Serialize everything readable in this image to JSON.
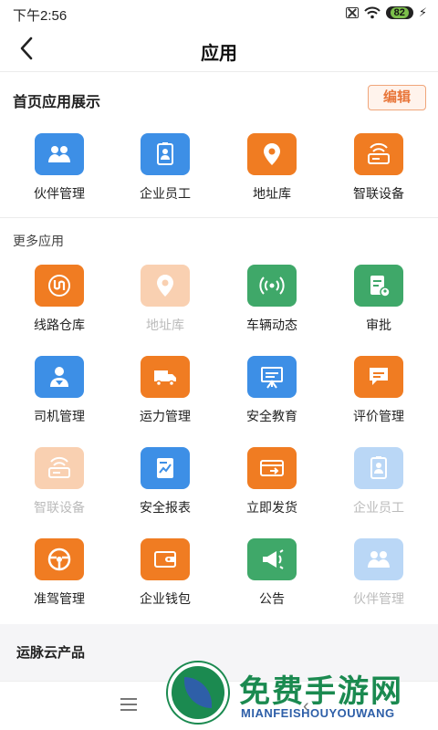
{
  "status_bar": {
    "time": "下午2:56",
    "battery": "82"
  },
  "header": {
    "title": "应用"
  },
  "home_section": {
    "title": "首页应用展示",
    "edit_label": "编辑",
    "apps": [
      {
        "label": "伙伴管理",
        "icon": "partners-icon",
        "color": "#3d8fe6"
      },
      {
        "label": "企业员工",
        "icon": "employee-badge-icon",
        "color": "#3d8fe6"
      },
      {
        "label": "地址库",
        "icon": "location-pin-icon",
        "color": "#f07c22"
      },
      {
        "label": "智联设备",
        "icon": "router-device-icon",
        "color": "#f07c22"
      }
    ]
  },
  "more_section": {
    "title": "更多应用",
    "apps": [
      {
        "label": "线路仓库",
        "icon": "route-icon",
        "color": "#f07c22",
        "disabled": false
      },
      {
        "label": "地址库",
        "icon": "location-pin-icon",
        "color": "#f07c22",
        "disabled": true
      },
      {
        "label": "车辆动态",
        "icon": "signal-broadcast-icon",
        "color": "#3fa869",
        "disabled": false
      },
      {
        "label": "审批",
        "icon": "approval-doc-icon",
        "color": "#3fa869",
        "disabled": false
      },
      {
        "label": "司机管理",
        "icon": "driver-icon",
        "color": "#3d8fe6",
        "disabled": false
      },
      {
        "label": "运力管理",
        "icon": "truck-icon",
        "color": "#f07c22",
        "disabled": false
      },
      {
        "label": "安全教育",
        "icon": "presentation-board-icon",
        "color": "#3d8fe6",
        "disabled": false
      },
      {
        "label": "评价管理",
        "icon": "comment-icon",
        "color": "#f07c22",
        "disabled": false
      },
      {
        "label": "智联设备",
        "icon": "router-device-icon",
        "color": "#f07c22",
        "disabled": true
      },
      {
        "label": "安全报表",
        "icon": "report-chart-icon",
        "color": "#3d8fe6",
        "disabled": false
      },
      {
        "label": "立即发货",
        "icon": "ship-now-icon",
        "color": "#f07c22",
        "disabled": false
      },
      {
        "label": "企业员工",
        "icon": "employee-badge-icon",
        "color": "#3d8fe6",
        "disabled": true
      },
      {
        "label": "准驾管理",
        "icon": "steering-wheel-icon",
        "color": "#f07c22",
        "disabled": false
      },
      {
        "label": "企业钱包",
        "icon": "wallet-icon",
        "color": "#f07c22",
        "disabled": false
      },
      {
        "label": "公告",
        "icon": "megaphone-icon",
        "color": "#3fa869",
        "disabled": false
      },
      {
        "label": "伙伴管理",
        "icon": "partners-icon",
        "color": "#3d8fe6",
        "disabled": true
      }
    ]
  },
  "product_section": {
    "title": "运脉云产品"
  },
  "watermark": {
    "cn": "免费手游网",
    "en": "MIANFEISHOUYOUWANG"
  }
}
